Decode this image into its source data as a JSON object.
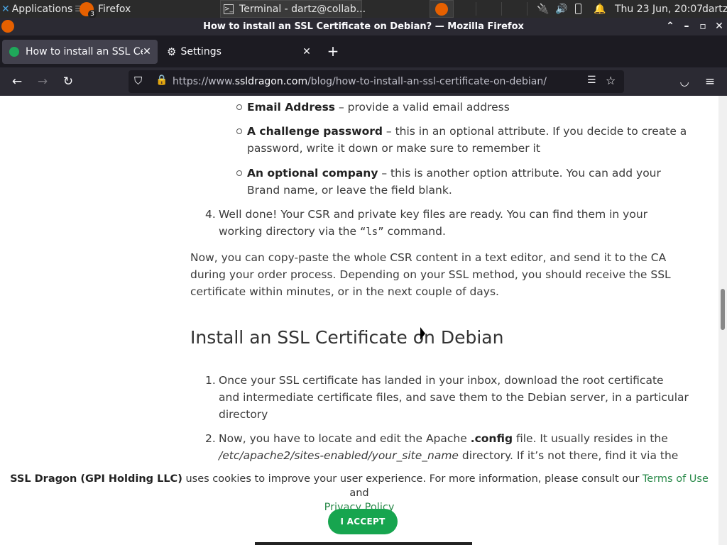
{
  "panel": {
    "apps_label": "Applications",
    "apps_suffix": "☰",
    "firefox_task": "Firefox",
    "firefox_badge": "3",
    "terminal_task": "Terminal - dartz@collab...",
    "clock": "Thu 23 Jun, 20:07",
    "user": "dartz"
  },
  "window": {
    "title": "How to install an SSL Certificate on Debian? — Mozilla Firefox"
  },
  "tabs": [
    {
      "label": "How to install an SSL Cer"
    },
    {
      "label": "Settings"
    }
  ],
  "nav": {
    "url_prefix": "https://www.",
    "url_host": "ssldragon.com",
    "url_path": "/blog/how-to-install-an-ssl-certificate-on-debian/"
  },
  "article": {
    "email_bold": "Email Address",
    "email_rest": " – provide a valid email address",
    "challenge_bold": "A challenge password",
    "challenge_rest1": " – this in an optional attribute. If you decide to create a",
    "challenge_rest2": "password, write it down or make sure to remember it",
    "company_bold": "An optional company",
    "company_rest1": " – this is another option attribute. You can add your",
    "company_rest2": "Brand name, or leave the field blank.",
    "step4_num": "4.",
    "step4_line1": "Well done! Your CSR and private key files are ready. You can find them in your",
    "step4_line2a": "working directory via the ",
    "step4_code": "“ls”",
    "step4_line2b": " command.",
    "para_line1": "Now, you can copy-paste the whole CSR content in a text editor, and send it to the CA",
    "para_line2": "during your order process. Depending on your SSL method, you should receive the SSL",
    "para_line3": "certificate within minutes, or in the next couple of days.",
    "heading": "Install an SSL Certificate on Debian",
    "step1_num": "1.",
    "step1_line1": "Once your SSL certificate has landed in your inbox, download the root certificate",
    "step1_line2": "and intermediate certificate files, and save them to the Debian server, in a particular",
    "step1_line3": "directory",
    "step2_num": "2.",
    "step2_line1a": "Now, you have to locate and edit the Apache ",
    "step2_bold": ".config",
    "step2_line1b": " file. It usually resides in the",
    "step2_italic": "/etc/apache2/sites-enabled/your_site_name",
    "step2_line2b": " directory. If it’s not there, find it via the"
  },
  "cookie": {
    "company": "SSL Dragon (GPI Holding LLC)",
    "text": " uses cookies to improve your user experience. For more information, please consult our ",
    "terms": "Terms of Use",
    "and": " and",
    "privacy": "Privacy Policy",
    "accept": "I ACCEPT"
  },
  "colors": {
    "accent_green": "#17a54f",
    "link_green": "#2a8a4a"
  }
}
